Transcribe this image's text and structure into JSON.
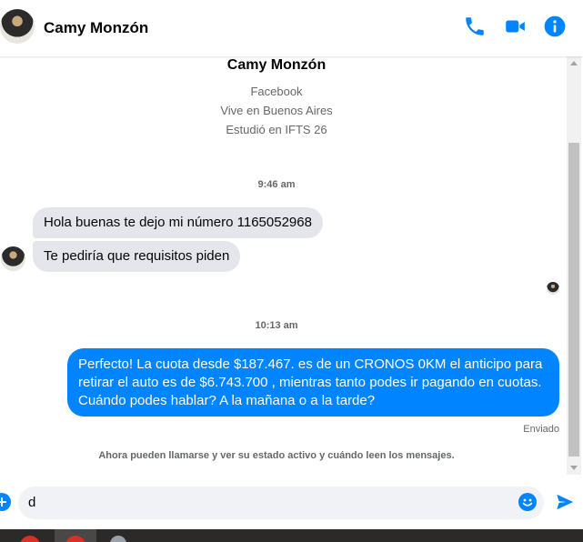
{
  "header": {
    "contact_name": "Camy Monzón",
    "icons": [
      "phone-icon",
      "video-camera-icon",
      "info-icon"
    ],
    "accent_color": "#0084ff"
  },
  "profile": {
    "name": "Camy Monzón",
    "lines": [
      "Facebook",
      "Vive en Buenos Aires",
      "Estudió en IFTS 26"
    ]
  },
  "conversation": {
    "timestamp_1": "9:46 am",
    "incoming": [
      "Hola buenas te dejo mi número 1165052968",
      "Te pediría que requisitos piden"
    ],
    "timestamp_2": "10:13 am",
    "outgoing": {
      "lines": [
        "Perfecto! La cuota desde $187.467. es de un CRONOS 0KM el anticipo para",
        "retirar el auto es de $6.743.700 , mientras tanto podes ir pagando en cuotas.",
        "Cuándo podes hablar? A la mañana o a la tarde?"
      ],
      "status": "Enviado"
    },
    "info": "Ahora pueden llamarse y ver su estado activo y cuándo leen los mensajes."
  },
  "composer": {
    "value": "d",
    "icons": [
      "plus-icon",
      "emoji-icon",
      "send-icon"
    ]
  }
}
